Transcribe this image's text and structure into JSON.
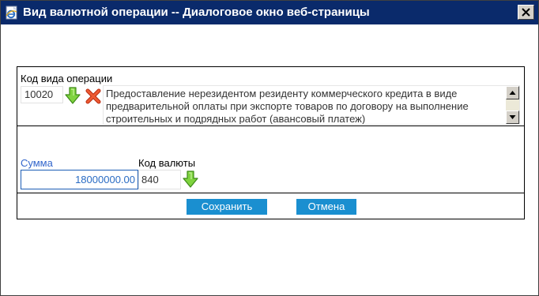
{
  "window": {
    "title": "Вид валютной операции -- Диалоговое окно веб-страницы"
  },
  "operation": {
    "label": "Код вида операции",
    "code_value": "10020",
    "description": "Предоставление нерезидентом резиденту коммерческого кредита в виде предварительной оплаты при экспорте товаров по договору на выполнение строительных и подрядных работ (авансовый платеж)"
  },
  "amount": {
    "label": "Сумма",
    "value": "18000000.00"
  },
  "currency": {
    "label": "Код валюты",
    "value": "840"
  },
  "buttons": {
    "save_label": "Сохранить",
    "cancel_label": "Отмена"
  },
  "icons": {
    "title": "ie-page-icon",
    "close": "close-icon",
    "select_operation": "green-down-arrow-icon",
    "clear_operation": "red-x-icon",
    "select_currency": "green-down-arrow-icon",
    "scroll_up": "scroll-up-arrow-icon",
    "scroll_down": "scroll-down-arrow-icon"
  },
  "colors": {
    "titlebar": "#0a2a6b",
    "button": "#1a8fd0",
    "sum_label": "#3366cc",
    "arrow_green": "#5cb82a",
    "x_red": "#e0442a"
  }
}
